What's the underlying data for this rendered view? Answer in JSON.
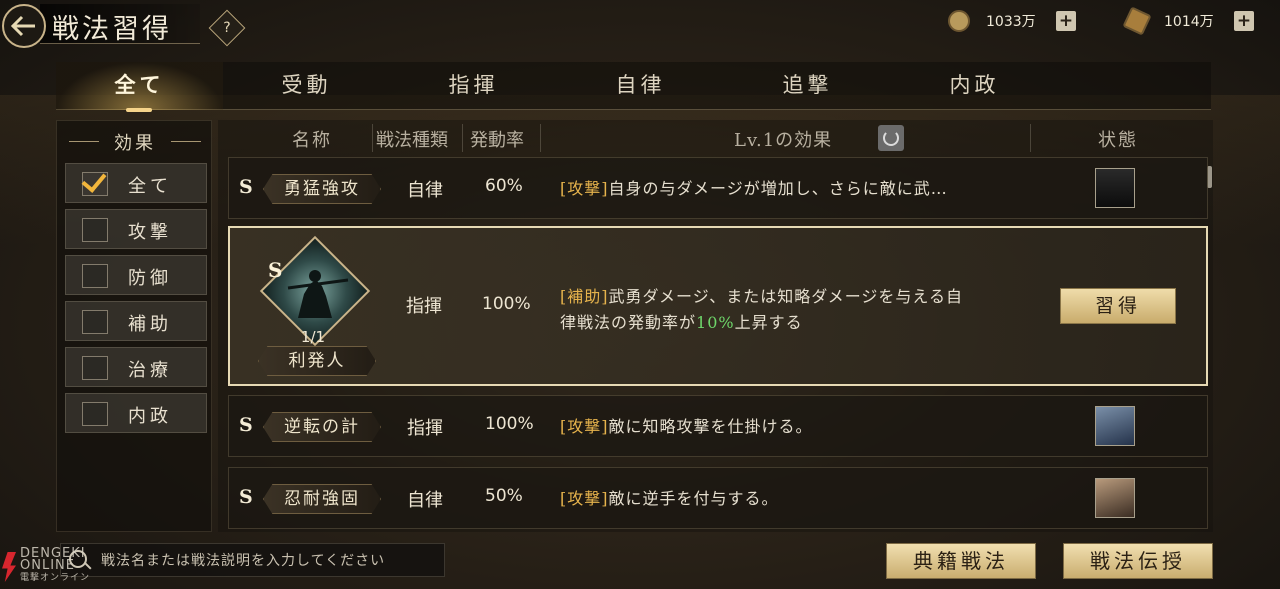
{
  "header": {
    "title": "戦法習得",
    "help_label": "?",
    "currencies": [
      {
        "icon": "coin-icon",
        "value": "1033万"
      },
      {
        "icon": "scroll-icon",
        "value": "1014万"
      }
    ],
    "plus_label": "+"
  },
  "tabs": [
    {
      "label": "全て",
      "active": true
    },
    {
      "label": "受動",
      "active": false
    },
    {
      "label": "指揮",
      "active": false
    },
    {
      "label": "自律",
      "active": false
    },
    {
      "label": "追撃",
      "active": false
    },
    {
      "label": "内政",
      "active": false
    }
  ],
  "filter": {
    "title": "効果",
    "items": [
      {
        "label": "全て",
        "checked": true
      },
      {
        "label": "攻撃",
        "checked": false
      },
      {
        "label": "防御",
        "checked": false
      },
      {
        "label": "補助",
        "checked": false
      },
      {
        "label": "治療",
        "checked": false
      },
      {
        "label": "内政",
        "checked": false
      }
    ]
  },
  "columns": {
    "name": "名称",
    "type": "戦法種類",
    "rate": "発動率",
    "effect": "Lv.1の効果",
    "status": "状態"
  },
  "rows": [
    {
      "rank": "S",
      "name": "勇猛強攻",
      "type": "自律",
      "rate": "60%",
      "tag": "[攻撃]",
      "effect": "自身の与ダメージが増加し、さらに敵に武…",
      "status_icon": "helmet-portrait"
    },
    {
      "rank": "S",
      "name": "逆転の計",
      "type": "指揮",
      "rate": "100%",
      "tag": "[攻撃]",
      "effect": "敵に知略攻撃を仕掛ける。",
      "status_icon": "warrior-portrait"
    },
    {
      "rank": "S",
      "name": "忍耐強固",
      "type": "自律",
      "rate": "50%",
      "tag": "[攻撃]",
      "effect": "敵に逆手を付与する。",
      "status_icon": "monk-portrait"
    }
  ],
  "expanded": {
    "rank": "S",
    "level": "1/1",
    "name": "利発人",
    "type": "指揮",
    "rate": "100%",
    "tag": "[補助]",
    "effect_line1": "武勇ダメージ、または知略ダメージを与える自",
    "effect_line2a": "律戦法の発動率が",
    "effect_highlight": "10%",
    "effect_line2b": "上昇する",
    "learn_label": "習得",
    "highlight_color": "#6ed66a"
  },
  "bottom": {
    "search_placeholder": "戦法名または戦法説明を入力してください",
    "btn_classics": "典籍戦法",
    "btn_transfer": "戦法伝授",
    "watermark_line1": "DENGEKI",
    "watermark_line2": "ONLINE",
    "watermark_line3": "電撃オンライン"
  },
  "colors": {
    "accent": "#e6b34c",
    "gold_button": "#e2c98c"
  }
}
